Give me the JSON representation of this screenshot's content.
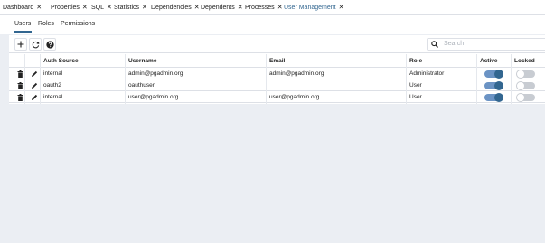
{
  "tabs": [
    {
      "label": "Dashboard",
      "active": false
    },
    {
      "label": "Properties",
      "active": false
    },
    {
      "label": "SQL",
      "active": false
    },
    {
      "label": "Statistics",
      "active": false
    },
    {
      "label": "Dependencies",
      "active": false
    },
    {
      "label": "Dependents",
      "active": false
    },
    {
      "label": "Processes",
      "active": false
    },
    {
      "label": "User Management",
      "active": true
    }
  ],
  "close_glyph": "✕",
  "subtabs": [
    {
      "label": "Users",
      "active": true
    },
    {
      "label": "Roles",
      "active": false
    },
    {
      "label": "Permissions",
      "active": false
    }
  ],
  "toolbar": {
    "add_icon": "plus-icon",
    "refresh_icon": "refresh-icon",
    "help_icon": "help-icon",
    "search_placeholder": "Search"
  },
  "table": {
    "columns": [
      "Auth Source",
      "Username",
      "Email",
      "Role",
      "Active",
      "Locked"
    ],
    "rows": [
      {
        "auth_source": "internal",
        "username": "admin@pgadmin.org",
        "email": "admin@pgadmin.org",
        "role": "Administrator",
        "active": true,
        "locked": false
      },
      {
        "auth_source": "oauth2",
        "username": "oauthuser",
        "email": "",
        "role": "User",
        "active": true,
        "locked": false
      },
      {
        "auth_source": "internal",
        "username": "user@pgadmin.org",
        "email": "user@pgadmin.org",
        "role": "User",
        "active": true,
        "locked": false
      }
    ]
  },
  "colors": {
    "accent": "#326690",
    "toggle_on_track": "#6b93c4",
    "toggle_off_track": "#c8ccd2",
    "background": "#ebeef3"
  }
}
